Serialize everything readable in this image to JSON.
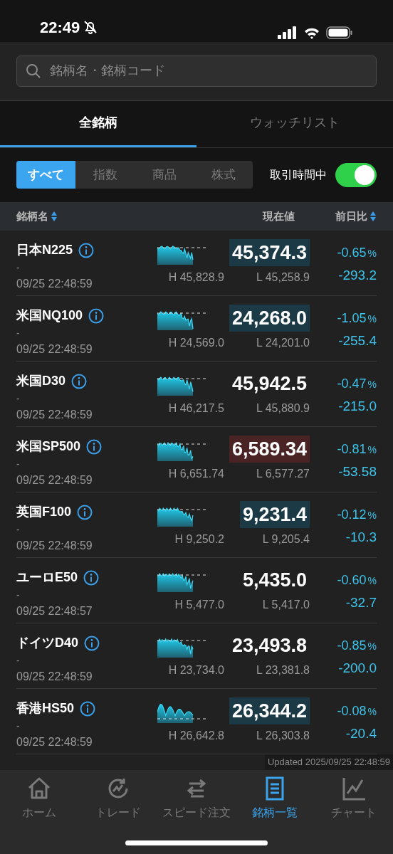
{
  "status_bar": {
    "time": "22:49"
  },
  "search": {
    "placeholder": "銘柄名・銘柄コード"
  },
  "tabs": [
    {
      "label": "全銘柄",
      "selected": true
    },
    {
      "label": "ウォッチリスト",
      "selected": false
    }
  ],
  "filters": [
    {
      "label": "すべて",
      "selected": true
    },
    {
      "label": "指数",
      "selected": false
    },
    {
      "label": "商品",
      "selected": false
    },
    {
      "label": "株式",
      "selected": false
    }
  ],
  "trading_hours_toggle": {
    "label": "取引時間中",
    "on": true
  },
  "columns": [
    "銘柄名",
    "現在値",
    "前日比"
  ],
  "rows": [
    {
      "name": "日本N225",
      "sub": "-",
      "time": "09/25 22:48:59",
      "high": "H 45,828.9",
      "low": "L 45,258.9",
      "price": "45,374.3",
      "color": "#1c3a45",
      "change_pct": "-0.65",
      "pct_sign": "%",
      "change": "-293.2"
    },
    {
      "name": "米国NQ100",
      "sub": "-",
      "time": "09/25 22:48:59",
      "high": "H 24,569.0",
      "low": "L 24,201.0",
      "price": "24,268.0",
      "color": "#1c3a45",
      "change_pct": "-1.05",
      "pct_sign": "%",
      "change": "-255.4"
    },
    {
      "name": "米国D30",
      "sub": "-",
      "time": "09/25 22:48:59",
      "high": "H 46,217.5",
      "low": "L 45,880.9",
      "price": "45,942.5",
      "change_pct": "-0.47",
      "pct_sign": "%",
      "change": "-215.0"
    },
    {
      "name": "米国SP500",
      "sub": "-",
      "time": "09/25 22:48:59",
      "high": "H 6,651.74",
      "low": "L 6,577.27",
      "price": "6,589.34",
      "color": "#4a2325",
      "change_pct": "-0.81",
      "pct_sign": "%",
      "change": "-53.58"
    },
    {
      "name": "英国F100",
      "sub": "-",
      "time": "09/25 22:48:59",
      "high": "H 9,250.2",
      "low": "L 9,205.4",
      "price": "9,231.4",
      "color": "#1c3a45",
      "change_pct": "-0.12",
      "pct_sign": "%",
      "change": "-10.3"
    },
    {
      "name": "ユーロE50",
      "sub": "-",
      "time": "09/25 22:48:57",
      "high": "H 5,477.0",
      "low": "L 5,417.0",
      "price": "5,435.0",
      "change_pct": "-0.60",
      "pct_sign": "%",
      "change": "-32.7"
    },
    {
      "name": "ドイツD40",
      "sub": "-",
      "time": "09/25 22:48:59",
      "high": "H 23,734.0",
      "low": "L 23,381.8",
      "price": "23,493.8",
      "change_pct": "-0.85",
      "pct_sign": "%",
      "change": "-200.0"
    },
    {
      "name": "香港HS50",
      "sub": "-",
      "time": "09/25 22:48:59",
      "high": "H 26,642.8",
      "low": "L 26,303.8",
      "price": "26,344.2",
      "color": "#1c3a45",
      "change_pct": "-0.08",
      "pct_sign": "%",
      "change": "-20.4"
    }
  ],
  "updated": "Updated 2025/09/25 22:48:59",
  "bottom_nav": [
    {
      "label": "ホーム",
      "selected": false
    },
    {
      "label": "トレード",
      "selected": false
    },
    {
      "label": "スピード注文",
      "selected": false
    },
    {
      "label": "銘柄一覧",
      "selected": true
    },
    {
      "label": "チャート",
      "selected": false
    }
  ]
}
